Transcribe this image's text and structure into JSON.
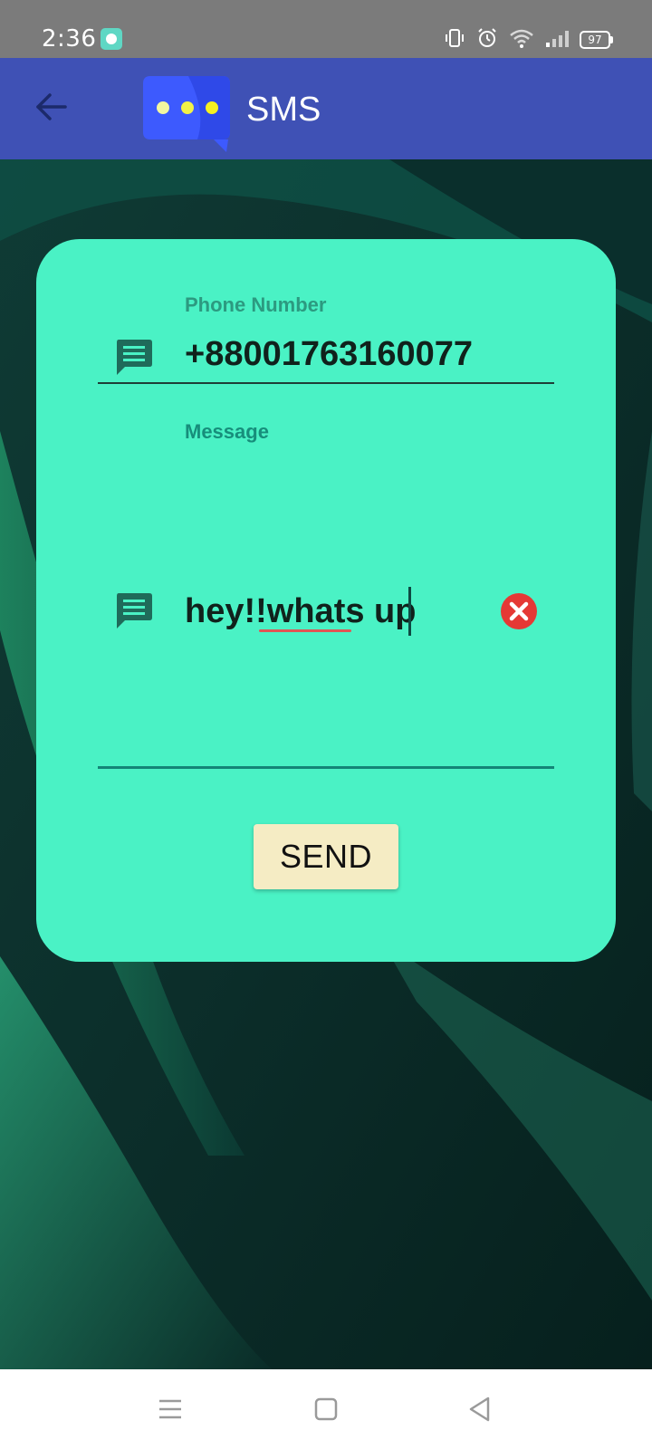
{
  "status_bar": {
    "time": "2:36",
    "battery": "97"
  },
  "app_bar": {
    "title": "SMS",
    "color": "#3f51b5"
  },
  "form": {
    "phone_label": "Phone Number",
    "phone_value": "+88001763160077",
    "message_label": "Message",
    "message_value": "hey!!whats up",
    "send_label": "SEND",
    "card_color": "#4af2c5",
    "send_color": "#f5ecc4",
    "clear_color": "#e53935"
  },
  "icons": {
    "back": "arrow-left-icon",
    "phone_field": "message-bubble-icon",
    "message_field": "message-bubble-icon",
    "clear": "clear-circle-icon",
    "nav_menu": "menu-icon",
    "nav_home": "home-square-icon",
    "nav_back": "triangle-back-icon"
  }
}
